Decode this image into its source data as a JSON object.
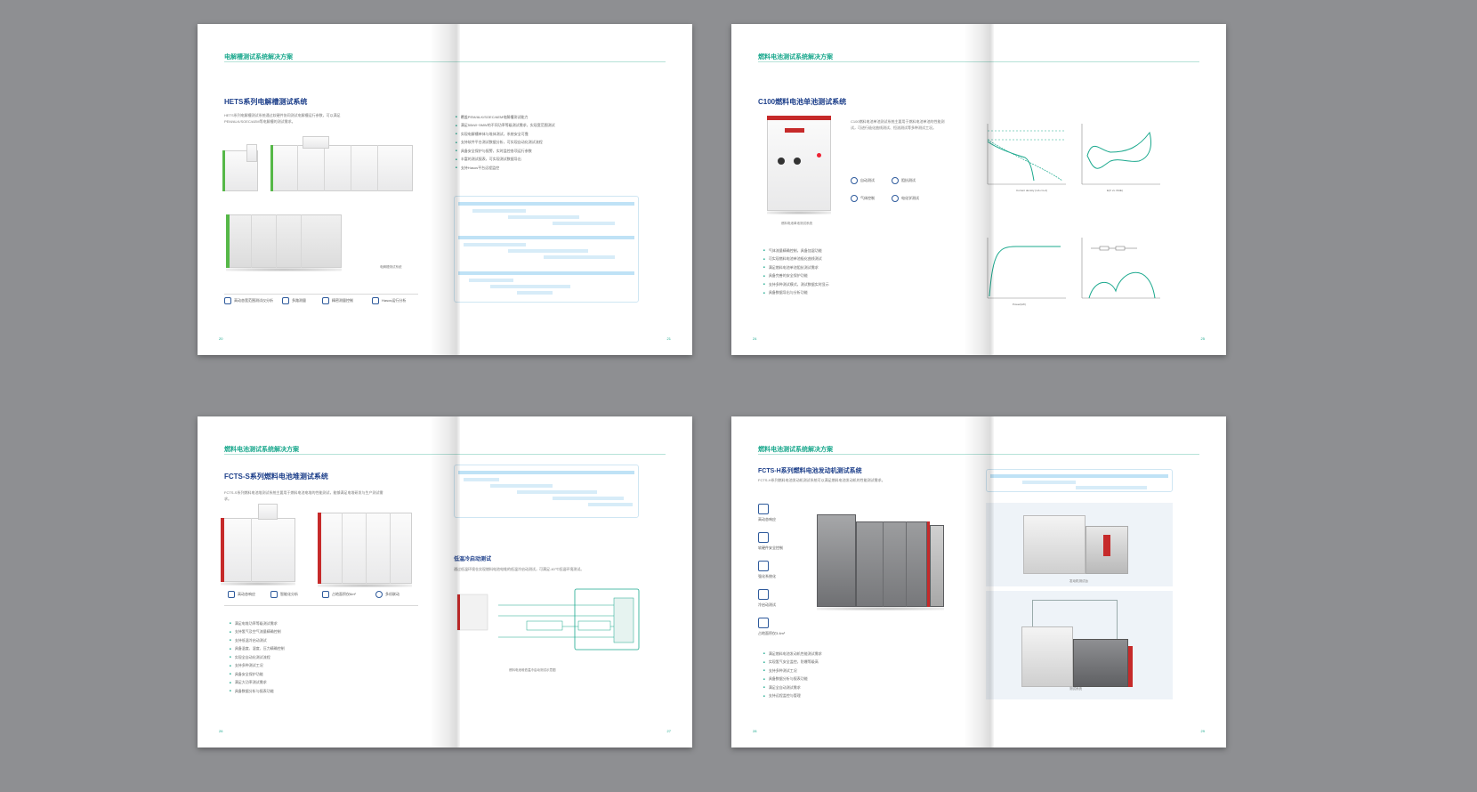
{
  "spreads": [
    {
      "header": "电解槽测试系统解决方案",
      "title": "HETS系列电解槽测试系统",
      "intro": "HETS系列电解槽测试系统通过软硬件协同测试电解槽运行参数，可以满足PEM/ALK/SOEC/AEM等电解槽的测试需求。",
      "caption": "电解槽测试系统",
      "features": [
        "高动态宽范围测试仪分析",
        "多路测量",
        "精密测量控制",
        "Hasos运行分析"
      ],
      "bullets": [
        "覆盖PEM/ALK/SOEC/AEM电解槽测试能力",
        "满足50kW~5MW的不同功率等级测试需求，实现宽范围测试",
        "实现电解槽单体与堆体测试，系统安全可靠",
        "支持软件平台测试数据分析，可实现自动化测试流程",
        "具备安全保护与报警，实时监控各项运行参数",
        "丰富的测试报表，可实现测试数据导出",
        "支持Hasos平台远程监控"
      ],
      "page_left": "20",
      "page_right": "21"
    },
    {
      "header": "燃料电池测试系统解决方案",
      "title": "C100燃料电池单池测试系统",
      "intro": "C100燃料电池单池测试系统主要用于燃料电池单池的性能测试，可进行极化曲线测试、恒流测试等多种测试工况。",
      "caption": "燃料电池单池测试系统",
      "features": [
        "自动测试",
        "阻抗测试",
        "气体控制",
        "电化学测试"
      ],
      "bullets": [
        "气体流量精确控制，具备加湿功能",
        "可实现燃料电池单池极化曲线测试",
        "满足燃料电池单池阻抗测试需求",
        "具备完善的安全保护功能",
        "支持多种测试模式，测试数据实时显示",
        "具备数据导出与分析功能"
      ],
      "chart_labels": [
        "Voltage(V)",
        "Current density (mA cm-2)",
        "E(V vs. RHE)",
        "Power(kW)"
      ],
      "page_left": "24",
      "page_right": "25"
    },
    {
      "header": "燃料电池测试系统解决方案",
      "title": "FCTS-S系列燃料电池堆测试系统",
      "intro": "FCTS-S系列燃料电池堆测试系统主要用于燃料电池电堆的性能测试，能够满足电堆研发与生产测试需求。",
      "features": [
        "高动态响应",
        "智能化分析",
        "占地面积仅6m²",
        "多机联动"
      ],
      "bullets": [
        "满足电堆功率等级测试需求",
        "支持氢气及空气流量精确控制",
        "支持低温冷启动测试",
        "具备温度、湿度、压力精确控制",
        "实现全自动化测试流程",
        "支持多种测试工况",
        "具备安全保护功能",
        "满足大功率测试需求",
        "具备数据分析与报表功能"
      ],
      "sub_title": "低温冷启动测试",
      "sub_text": "通过低温环境仓实现燃料电池电堆的低温冷启动测试，可满足-40℃低温环境测试。",
      "diagram_caption": "燃料电池堆低温冷启动测试示意图",
      "page_left": "26",
      "page_right": "27"
    },
    {
      "header": "燃料电池测试系统解决方案",
      "title": "FCTS-H系列燃料电池发动机测试系统",
      "intro": "FCTS-H系列燃料电池发动机测试系统可以满足燃料电池发动机的性能测试需求。",
      "features": [
        "高动态响应",
        "软硬件安全控制",
        "强化系统化",
        "冷启动测试",
        "占地面积仅3.4m²"
      ],
      "bullets": [
        "满足燃料电池发动机性能测试需求",
        "实现氢气安全监控，防爆等级高",
        "支持多种测试工况",
        "具备数据分析与报表功能",
        "满足全自动测试需求",
        "支持远程监控与管理"
      ],
      "photo_caption_1": "发动机测试台",
      "photo_caption_2": "测试系统",
      "page_left": "28",
      "page_right": "29"
    }
  ]
}
